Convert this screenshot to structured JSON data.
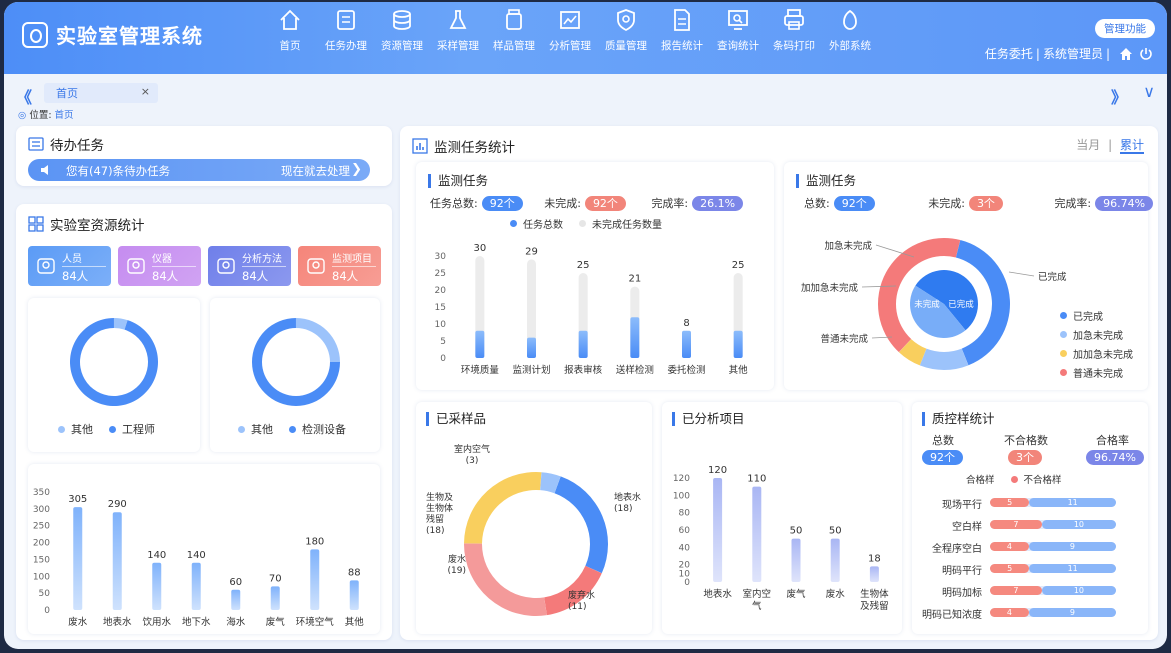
{
  "app_title": "实验室管理系统",
  "nav": [
    {
      "label": "首页",
      "icon": "home-icon"
    },
    {
      "label": "任务办理",
      "icon": "task-icon"
    },
    {
      "label": "资源管理",
      "icon": "database-icon"
    },
    {
      "label": "采样管理",
      "icon": "flask-icon"
    },
    {
      "label": "样品管理",
      "icon": "jar-icon"
    },
    {
      "label": "分析管理",
      "icon": "chart-icon"
    },
    {
      "label": "质量管理",
      "icon": "shield-icon"
    },
    {
      "label": "报告统计",
      "icon": "report-icon"
    },
    {
      "label": "查询统计",
      "icon": "monitor-search-icon"
    },
    {
      "label": "条码打印",
      "icon": "printer-icon"
    },
    {
      "label": "外部系统",
      "icon": "external-icon"
    }
  ],
  "header": {
    "admin_label": "管理功能",
    "user_a": "任务委托",
    "sep": "|",
    "user_b": "系统管理员",
    "sep2": "|"
  },
  "tabs": {
    "home_tab": "首页",
    "close": "×",
    "prev": "《",
    "next": "》",
    "down": "∨"
  },
  "breadcrumb": {
    "prefix": "位置:",
    "current": "首页"
  },
  "todo": {
    "title": "待办任务",
    "message": "您有(47)条待办任务",
    "action": "现在就去处理"
  },
  "resources": {
    "title": "实验室资源统计",
    "tiles": [
      {
        "label": "人员",
        "value": "84人",
        "color": "#5b9bf6"
      },
      {
        "label": "仪器",
        "value": "84人",
        "color": "#c58cf0"
      },
      {
        "label": "分析方法",
        "value": "84人",
        "color": "#6f7fea"
      },
      {
        "label": "监测项目",
        "value": "84人",
        "color": "#f5857a"
      }
    ],
    "donut1_legend": [
      "其他",
      "工程师"
    ],
    "donut2_legend": [
      "其他",
      "检测设备"
    ]
  },
  "colors": {
    "primary": "#4a8cf6",
    "light": "#9cc3fb",
    "red": "#f47a7a",
    "yellow": "#f9cf5e",
    "purple": "#7b86e8"
  },
  "monitor": {
    "title": "监测任务统计",
    "period_month": "当月",
    "period_sep": "|",
    "period_total": "累计",
    "task": {
      "title": "监测任务",
      "total_label": "任务总数:",
      "total": "92个",
      "unfinished_label": "未完成:",
      "unfinished": "92个",
      "rate_label": "完成率:",
      "rate": "26.1%",
      "legend": [
        "任务总数",
        "未完成任务数量"
      ]
    },
    "task2": {
      "title": "监测任务",
      "total_label": "总数:",
      "total": "92个",
      "unfinished_label": "未完成:",
      "unfinished": "3个",
      "rate_label": "完成率:",
      "rate": "96.74%",
      "legend": [
        "已完成",
        "加急未完成",
        "加加急未完成",
        "普通未完成"
      ],
      "callouts": [
        "加急未完成",
        "加加急未完成",
        "普通未完成",
        "已完成"
      ],
      "center": [
        "未完成",
        "已完成"
      ]
    },
    "samples": {
      "title": "已采样品"
    },
    "analysis": {
      "title": "已分析项目"
    },
    "qc": {
      "title": "质控样统计",
      "h_total": "总数",
      "h_bad": "不合格数",
      "h_rate": "合格率",
      "total": "92个",
      "bad": "3个",
      "rate": "96.74%",
      "legend": [
        "合格样",
        "不合格样"
      ],
      "rows": [
        {
          "label": "现场平行",
          "bad": "5",
          "good": "11"
        },
        {
          "label": "空白样",
          "bad": "7",
          "good": "10"
        },
        {
          "label": "全程序空白",
          "bad": "4",
          "good": "9"
        },
        {
          "label": "明码平行",
          "bad": "5",
          "good": "11"
        },
        {
          "label": "明码加标",
          "bad": "7",
          "good": "10"
        },
        {
          "label": "明码已知浓度",
          "bad": "4",
          "good": "9"
        }
      ]
    }
  },
  "chart_data": [
    {
      "type": "pie",
      "name": "donut1",
      "slices": [
        {
          "label": "其他",
          "value": 5
        },
        {
          "label": "工程师",
          "value": 95
        }
      ],
      "legend": "bottom"
    },
    {
      "type": "pie",
      "name": "donut2",
      "slices": [
        {
          "label": "其他",
          "value": 25
        },
        {
          "label": "检测设备",
          "value": 75
        }
      ],
      "legend": "bottom"
    },
    {
      "type": "bar",
      "name": "water",
      "categories": [
        "废水",
        "地表水",
        "饮用水",
        "地下水",
        "海水",
        "废气",
        "环境空气",
        "其他"
      ],
      "values": [
        305,
        290,
        140,
        140,
        60,
        70,
        180,
        88
      ],
      "ylim": [
        0,
        350
      ],
      "yticks": [
        0,
        50,
        100,
        150,
        200,
        250,
        300,
        350
      ]
    },
    {
      "type": "bar",
      "name": "monitor_tasks",
      "categories": [
        "环境质量",
        "监测计划",
        "报表审核",
        "送样检测",
        "委托检测",
        "其他"
      ],
      "series": [
        {
          "name": "任务总数",
          "values": [
            30,
            29,
            25,
            21,
            8,
            25
          ]
        },
        {
          "name": "未完成任务数量",
          "values": [
            8,
            6,
            8,
            12,
            8,
            8
          ]
        }
      ],
      "ylim": [
        0,
        30
      ],
      "yticks": [
        0,
        5,
        10,
        15,
        20,
        25,
        30
      ],
      "legend": "top"
    },
    {
      "type": "pie",
      "name": "task_status",
      "slices": [
        {
          "label": "已完成",
          "value": 40
        },
        {
          "label": "加急未完成",
          "value": 12
        },
        {
          "label": "加加急未完成",
          "value": 6
        },
        {
          "label": "普通未完成",
          "value": 42
        }
      ],
      "inner": [
        {
          "label": "未完成",
          "value": 55
        },
        {
          "label": "已完成",
          "value": 45
        }
      ],
      "legend": "right"
    },
    {
      "type": "pie",
      "name": "samples",
      "slices": [
        {
          "label": "地表水",
          "value": 18
        },
        {
          "label": "废弃水",
          "value": 11
        },
        {
          "label": "废水",
          "value": 19
        },
        {
          "label": "生物及生物体残留",
          "value": 18
        },
        {
          "label": "室内空气",
          "value": 3
        }
      ]
    },
    {
      "type": "bar",
      "name": "analysis",
      "categories": [
        "地表水",
        "室内空气",
        "废气",
        "废水",
        "生物体及残留"
      ],
      "values": [
        120,
        110,
        50,
        50,
        18
      ],
      "ylim": [
        0,
        120
      ],
      "yticks": [
        0,
        10,
        20,
        40,
        60,
        80,
        100,
        120
      ]
    },
    {
      "type": "bar",
      "name": "qc",
      "categories": [
        "现场平行",
        "空白样",
        "全程序空白",
        "明码平行",
        "明码加标",
        "明码已知浓度"
      ],
      "series": [
        {
          "name": "不合格样",
          "values": [
            5,
            7,
            4,
            5,
            7,
            4
          ]
        },
        {
          "name": "合格样",
          "values": [
            11,
            10,
            9,
            11,
            10,
            9
          ]
        }
      ]
    }
  ]
}
